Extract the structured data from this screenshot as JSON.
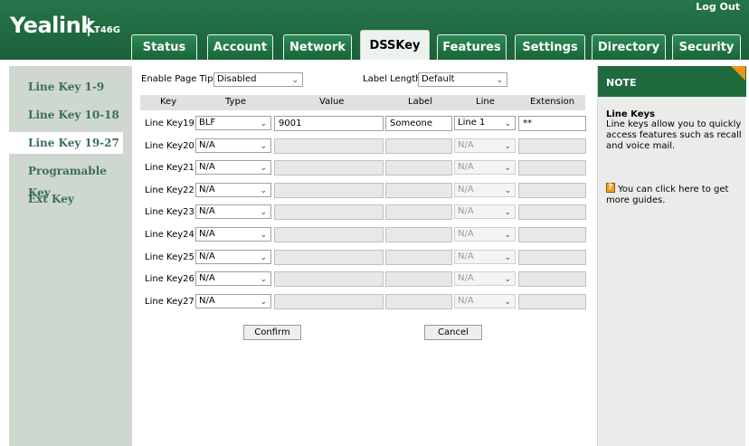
{
  "header": {
    "logo": "Yealink",
    "model": "T46G",
    "logout": "Log Out"
  },
  "tabs": [
    {
      "label": "Status"
    },
    {
      "label": "Account"
    },
    {
      "label": "Network"
    },
    {
      "label": "DSSKey"
    },
    {
      "label": "Features"
    },
    {
      "label": "Settings"
    },
    {
      "label": "Directory"
    },
    {
      "label": "Security"
    }
  ],
  "active_tab": "DSSKey",
  "sidebar": {
    "items": [
      {
        "label": "Line Key 1-9"
      },
      {
        "label": "Line Key 10-18"
      },
      {
        "label": "Line Key 19-27"
      },
      {
        "label": "Programable Key"
      },
      {
        "label": "Ext Key"
      }
    ],
    "active": "Line Key 19-27"
  },
  "form": {
    "page_tips_label": "Enable Page Tips",
    "page_tips_value": "Disabled",
    "label_length_label": "Label Length",
    "label_length_value": "Default",
    "columns": [
      "Key",
      "Type",
      "Value",
      "Label",
      "Line",
      "Extension"
    ],
    "rows": [
      {
        "key": "Line Key19",
        "type": "BLF",
        "value": "9001",
        "label": "Someone",
        "line": "Line 1",
        "extension": "**",
        "enabled": true
      },
      {
        "key": "Line Key20",
        "type": "N/A",
        "value": "",
        "label": "",
        "line": "N/A",
        "extension": "",
        "enabled": false
      },
      {
        "key": "Line Key21",
        "type": "N/A",
        "value": "",
        "label": "",
        "line": "N/A",
        "extension": "",
        "enabled": false
      },
      {
        "key": "Line Key22",
        "type": "N/A",
        "value": "",
        "label": "",
        "line": "N/A",
        "extension": "",
        "enabled": false
      },
      {
        "key": "Line Key23",
        "type": "N/A",
        "value": "",
        "label": "",
        "line": "N/A",
        "extension": "",
        "enabled": false
      },
      {
        "key": "Line Key24",
        "type": "N/A",
        "value": "",
        "label": "",
        "line": "N/A",
        "extension": "",
        "enabled": false
      },
      {
        "key": "Line Key25",
        "type": "N/A",
        "value": "",
        "label": "",
        "line": "N/A",
        "extension": "",
        "enabled": false
      },
      {
        "key": "Line Key26",
        "type": "N/A",
        "value": "",
        "label": "",
        "line": "N/A",
        "extension": "",
        "enabled": false
      },
      {
        "key": "Line Key27",
        "type": "N/A",
        "value": "",
        "label": "",
        "line": "N/A",
        "extension": "",
        "enabled": false
      }
    ],
    "confirm_label": "Confirm",
    "cancel_label": "Cancel"
  },
  "note": {
    "header": "NOTE",
    "title": "Line Keys",
    "text": "Line keys allow you to quickly access features such as recall and voice mail.",
    "guide": "You can click here to get more guides."
  },
  "colors": {
    "brand_green": "#1f6b3e",
    "accent_orange": "#f2921b",
    "sidebar_bg": "#ced8cf",
    "sidebar_text": "#3a6e5e"
  }
}
